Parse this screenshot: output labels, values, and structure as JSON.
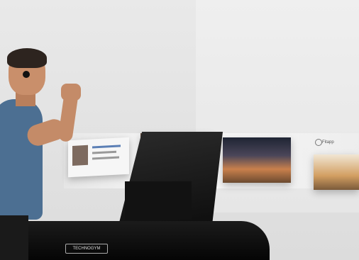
{
  "scene": {
    "description_icons": [
      "runner",
      "treadmill",
      "floating-media-cards"
    ],
    "app_card_label": "Fitapp",
    "treadmill_brand": "TECHNOGYM",
    "colors": {
      "background": "#e3e3e3",
      "treadmill": "#111111",
      "accent_strip": "#b0282a",
      "shirt": "#4c6f92"
    }
  }
}
